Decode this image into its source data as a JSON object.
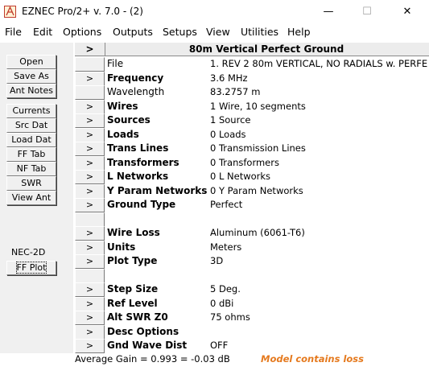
{
  "window": {
    "title": "EZNEC Pro/2+  v. 7.0 - (2)",
    "controls": {
      "minimize": "—",
      "maximize": "☐",
      "close": "✕"
    }
  },
  "menu": [
    "File",
    "Edit",
    "Options",
    "Outputs",
    "Setups",
    "View",
    "Utilities",
    "Help"
  ],
  "left_buttons_top": [
    "Open",
    "Save As",
    "Ant Notes"
  ],
  "left_buttons_bottom": [
    "Currents",
    "Src Dat",
    "Load Dat",
    "FF Tab",
    "NF Tab",
    "SWR",
    "View Ant"
  ],
  "engine_label": "NEC-2D",
  "ff_plot_label": "FF Plot",
  "grid": {
    "header_arrow": ">",
    "header_title": "80m Vertical Perfect Ground",
    "rows": [
      {
        "arrow": "",
        "label": "File",
        "bold": false,
        "value": "1. REV 2 80m VERTICAL, NO RADIALS w. PERFE"
      },
      {
        "arrow": ">",
        "label": "Frequency",
        "bold": true,
        "value": "3.6 MHz"
      },
      {
        "arrow": "",
        "label": "Wavelength",
        "bold": false,
        "value": "83.2757 m"
      },
      {
        "arrow": ">",
        "label": "Wires",
        "bold": true,
        "value": "1 Wire, 10 segments"
      },
      {
        "arrow": ">",
        "label": "Sources",
        "bold": true,
        "value": "1 Source"
      },
      {
        "arrow": ">",
        "label": "Loads",
        "bold": true,
        "value": "0 Loads"
      },
      {
        "arrow": ">",
        "label": "Trans Lines",
        "bold": true,
        "value": "0 Transmission Lines"
      },
      {
        "arrow": ">",
        "label": "Transformers",
        "bold": true,
        "value": "0 Transformers"
      },
      {
        "arrow": ">",
        "label": "L Networks",
        "bold": true,
        "value": "0 L Networks"
      },
      {
        "arrow": ">",
        "label": "Y Param Networks",
        "bold": true,
        "value": "0 Y Param Networks"
      },
      {
        "arrow": ">",
        "label": "Ground Type",
        "bold": true,
        "value": "Perfect"
      },
      {
        "arrow": "",
        "label": "",
        "bold": false,
        "value": ""
      },
      {
        "arrow": ">",
        "label": "Wire Loss",
        "bold": true,
        "value": "Aluminum (6061-T6)"
      },
      {
        "arrow": ">",
        "label": "Units",
        "bold": true,
        "value": "Meters"
      },
      {
        "arrow": ">",
        "label": "Plot Type",
        "bold": true,
        "value": "3D"
      },
      {
        "arrow": "",
        "label": "",
        "bold": false,
        "value": ""
      },
      {
        "arrow": ">",
        "label": "Step Size",
        "bold": true,
        "value": "5 Deg."
      },
      {
        "arrow": ">",
        "label": "Ref Level",
        "bold": true,
        "value": "0 dBi"
      },
      {
        "arrow": ">",
        "label": "Alt SWR Z0",
        "bold": true,
        "value": "75 ohms"
      },
      {
        "arrow": ">",
        "label": "Desc Options",
        "bold": true,
        "value": ""
      },
      {
        "arrow": ">",
        "label": "Gnd Wave Dist",
        "bold": true,
        "value": "OFF"
      }
    ]
  },
  "status": {
    "average_gain": "Average Gain = 0.993 = -0.03 dB",
    "loss_note": "Model contains loss",
    "loss_color": "#e57a1f"
  }
}
